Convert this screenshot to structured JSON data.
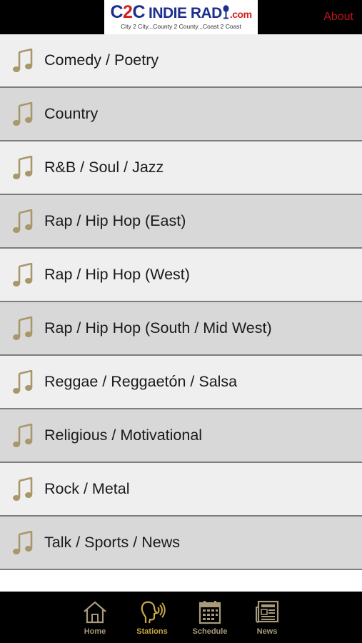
{
  "header": {
    "logo": {
      "brand_prefix": "C",
      "brand_two": "2",
      "brand_suffix": "C",
      "name_part1": "INDIE RAD",
      "name_part2": "O",
      "domain": ".com",
      "tagline": "City 2 City...County 2 County...Coast 2 Coast"
    },
    "about_label": "About"
  },
  "stations": [
    {
      "label": "Comedy / Poetry",
      "icon": "music-note-icon"
    },
    {
      "label": "Country",
      "icon": "music-note-icon"
    },
    {
      "label": "R&B / Soul / Jazz",
      "icon": "music-note-icon"
    },
    {
      "label": "Rap / Hip Hop (East)",
      "icon": "music-note-icon"
    },
    {
      "label": "Rap / Hip Hop (West)",
      "icon": "music-note-icon"
    },
    {
      "label": "Rap / Hip Hop (South / Mid West)",
      "icon": "music-note-icon"
    },
    {
      "label": "Reggae / Reggaetón / Salsa",
      "icon": "music-note-icon"
    },
    {
      "label": "Religious / Motivational",
      "icon": "music-note-icon"
    },
    {
      "label": "Rock / Metal",
      "icon": "music-note-icon"
    },
    {
      "label": "Talk / Sports / News",
      "icon": "music-note-icon"
    }
  ],
  "tabs": [
    {
      "label": "Home",
      "icon": "home-icon",
      "active": false
    },
    {
      "label": "Stations",
      "icon": "listener-icon",
      "active": true
    },
    {
      "label": "Schedule",
      "icon": "calendar-icon",
      "active": false
    },
    {
      "label": "News",
      "icon": "newspaper-icon",
      "active": false
    }
  ],
  "colors": {
    "header_bg": "#000000",
    "about_text": "#c0121b",
    "row_light": "#efefef",
    "row_dark": "#d8d8d8",
    "row_border": "#7d7d7d",
    "note_icon": "#a8976a",
    "tab_active": "#c9a746",
    "tab_inactive": "#a89a7a"
  }
}
